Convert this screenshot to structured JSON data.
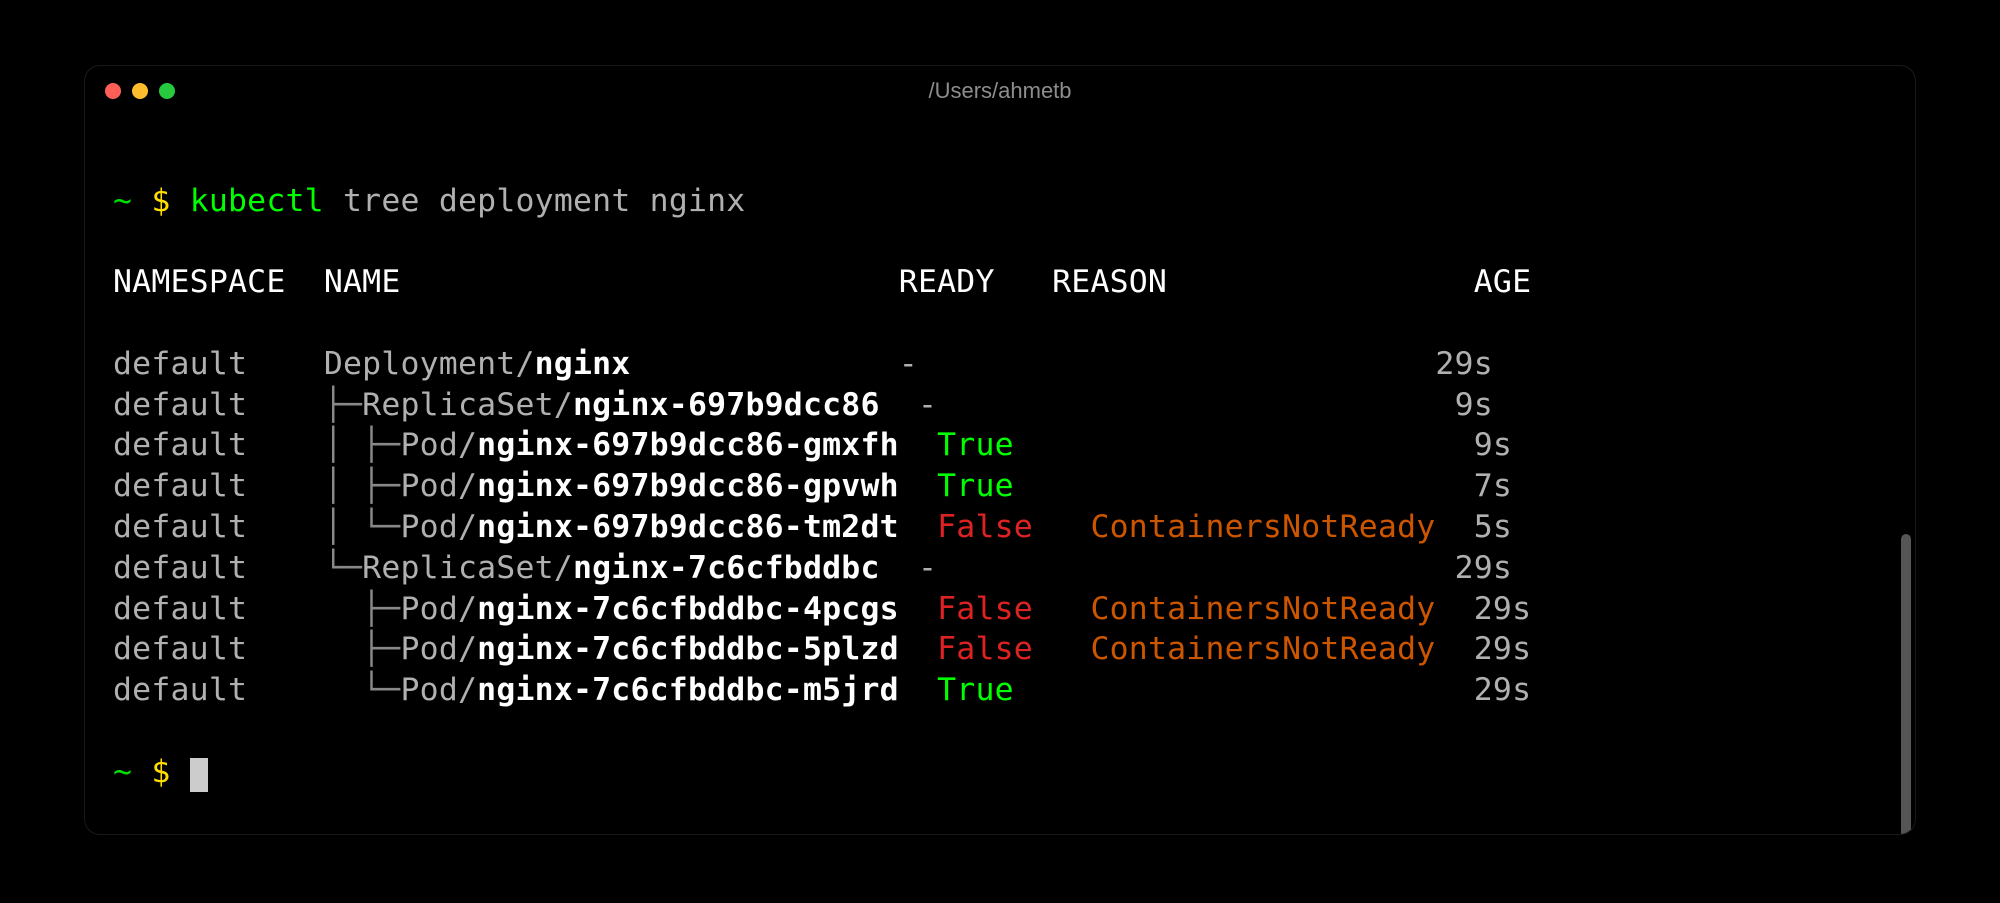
{
  "window": {
    "title": "/Users/ahmetb"
  },
  "prompt": {
    "tilde": "~",
    "dollar": "$",
    "command_exec": "kubectl",
    "command_args": "tree deployment nginx"
  },
  "headers": {
    "namespace": "NAMESPACE",
    "name": "NAME",
    "ready": "READY",
    "reason": "REASON",
    "age": "AGE"
  },
  "tree_chars": {
    "mid": "├─",
    "end": "└─",
    "pipe": "│ "
  },
  "rows": [
    {
      "ns": "default",
      "prefix": "",
      "kind": "Deployment/",
      "resname": "nginx",
      "ready": "-",
      "ready_class": "c-dim",
      "reason": "",
      "age": "29s"
    },
    {
      "ns": "default",
      "prefix": "├─",
      "kind": "ReplicaSet/",
      "resname": "nginx-697b9dcc86",
      "ready": "-",
      "ready_class": "c-dim",
      "reason": "",
      "age": "9s"
    },
    {
      "ns": "default",
      "prefix": "│ ├─",
      "kind": "Pod/",
      "resname": "nginx-697b9dcc86-gmxfh",
      "ready": "True",
      "ready_class": "c-bgreen",
      "reason": "",
      "age": "9s"
    },
    {
      "ns": "default",
      "prefix": "│ ├─",
      "kind": "Pod/",
      "resname": "nginx-697b9dcc86-gpvwh",
      "ready": "True",
      "ready_class": "c-bgreen",
      "reason": "",
      "age": "7s"
    },
    {
      "ns": "default",
      "prefix": "│ └─",
      "kind": "Pod/",
      "resname": "nginx-697b9dcc86-tm2dt",
      "ready": "False",
      "ready_class": "c-red",
      "reason": "ContainersNotReady",
      "age": "5s"
    },
    {
      "ns": "default",
      "prefix": "└─",
      "kind": "ReplicaSet/",
      "resname": "nginx-7c6cfbddbc",
      "ready": "-",
      "ready_class": "c-dim",
      "reason": "",
      "age": "29s"
    },
    {
      "ns": "default",
      "prefix": "  ├─",
      "kind": "Pod/",
      "resname": "nginx-7c6cfbddbc-4pcgs",
      "ready": "False",
      "ready_class": "c-red",
      "reason": "ContainersNotReady",
      "age": "29s"
    },
    {
      "ns": "default",
      "prefix": "  ├─",
      "kind": "Pod/",
      "resname": "nginx-7c6cfbddbc-5plzd",
      "ready": "False",
      "ready_class": "c-red",
      "reason": "ContainersNotReady",
      "age": "29s"
    },
    {
      "ns": "default",
      "prefix": "  └─",
      "kind": "Pod/",
      "resname": "nginx-7c6cfbddbc-m5jrd",
      "ready": "True",
      "ready_class": "c-bgreen",
      "reason": "",
      "age": "29s"
    }
  ],
  "layout": {
    "col_ns_width": 11,
    "col_name_width": 30,
    "col_ready_width": 7,
    "col_reason_width": 20,
    "col_age_width": 3
  }
}
